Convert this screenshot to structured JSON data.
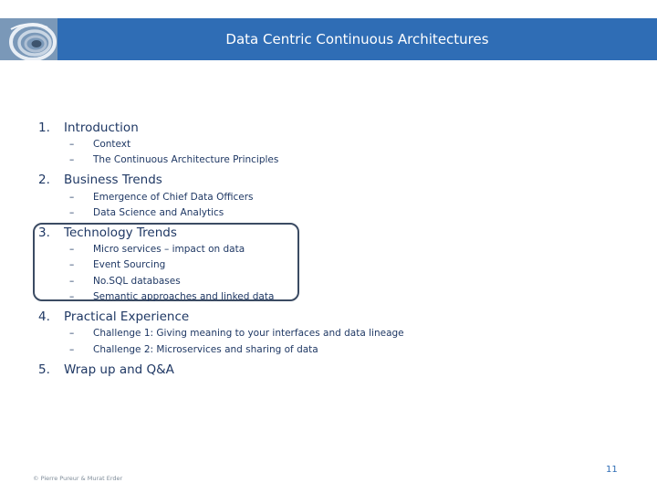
{
  "header": {
    "title": "Data Centric Continuous Architectures"
  },
  "logo": {
    "icon": "spiral-staircase-icon"
  },
  "agenda": [
    {
      "number": "1.",
      "title": "Introduction",
      "items": [
        "Context",
        "The Continuous Architecture Principles"
      ]
    },
    {
      "number": "2.",
      "title": "Business Trends",
      "items": [
        "Emergence of Chief Data Officers",
        "Data Science and Analytics"
      ]
    },
    {
      "number": "3.",
      "title": "Technology Trends",
      "items": [
        "Micro services – impact on data",
        "Event Sourcing",
        "No.SQL databases",
        "Semantic approaches and linked data"
      ]
    },
    {
      "number": "4.",
      "title": "Practical Experience",
      "items": [
        "Challenge 1: Giving meaning to your interfaces and data lineage",
        "Challenge 2: Microservices and sharing of data"
      ]
    },
    {
      "number": "5.",
      "title": "Wrap up and Q&A",
      "items": []
    }
  ],
  "dash": "–",
  "footer": {
    "copyright": "© Pierre Pureur & Murat Erder"
  },
  "page_number": "11"
}
